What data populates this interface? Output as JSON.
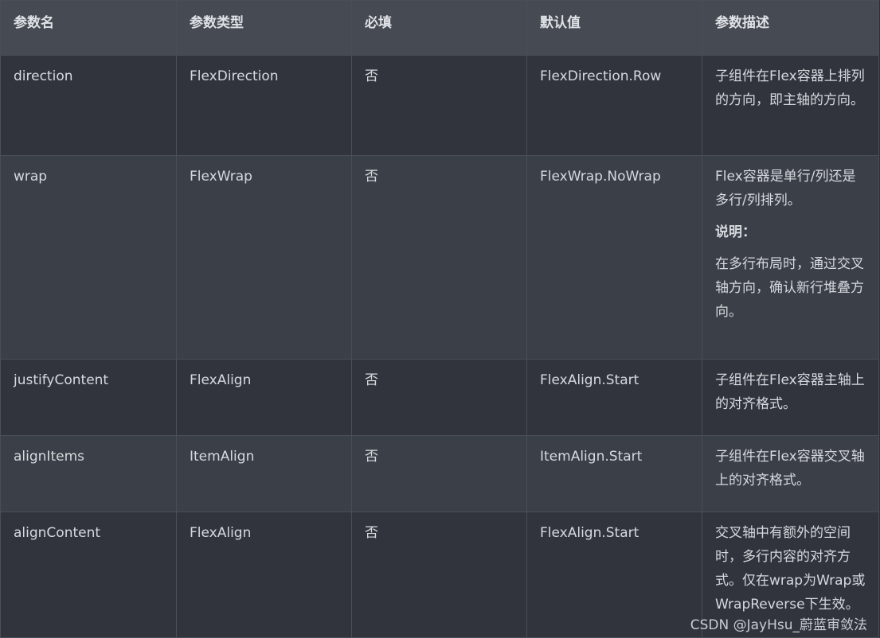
{
  "table": {
    "headers": [
      "参数名",
      "参数类型",
      "必填",
      "默认值",
      "参数描述"
    ],
    "rows": [
      {
        "name": "direction",
        "type": "FlexDirection",
        "required": "否",
        "default": "FlexDirection.Row",
        "description": "子组件在Flex容器上排列的方向，即主轴的方向。"
      },
      {
        "name": "wrap",
        "type": "FlexWrap",
        "required": "否",
        "default": "FlexWrap.NoWrap",
        "description": "Flex容器是单行/列还是多行/列排列。",
        "note_title": "说明：",
        "note_body": "在多行布局时，通过交叉轴方向，确认新行堆叠方向。"
      },
      {
        "name": "justifyContent",
        "type": "FlexAlign",
        "required": "否",
        "default": "FlexAlign.Start",
        "description": "子组件在Flex容器主轴上的对齐格式。"
      },
      {
        "name": "alignItems",
        "type": "ItemAlign",
        "required": "否",
        "default": "ItemAlign.Start",
        "description": "子组件在Flex容器交叉轴上的对齐格式。"
      },
      {
        "name": "alignContent",
        "type": "FlexAlign",
        "required": "否",
        "default": "FlexAlign.Start",
        "description": "交叉轴中有额外的空间时，多行内容的对齐方式。仅在wrap为Wrap或WrapReverse下生效。"
      }
    ]
  },
  "watermark": "CSDN @JayHsu_蔚蓝审敛法"
}
